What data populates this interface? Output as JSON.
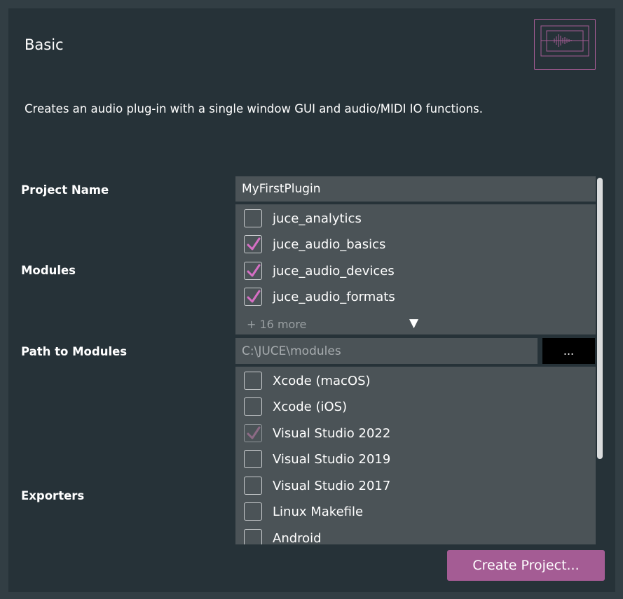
{
  "template": {
    "title": "Basic",
    "description": "Creates an audio plug-in with a single window GUI and audio/MIDI IO functions."
  },
  "form": {
    "project_name_label": "Project Name",
    "project_name_value": "MyFirstPlugin",
    "modules_label": "Modules",
    "modules": [
      {
        "label": "juce_analytics",
        "checked": false
      },
      {
        "label": "juce_audio_basics",
        "checked": true
      },
      {
        "label": "juce_audio_devices",
        "checked": true
      },
      {
        "label": "juce_audio_formats",
        "checked": true
      }
    ],
    "modules_more": "+ 16 more",
    "modules_expand_glyph": "▼",
    "path_label": "Path to Modules",
    "path_value": "C:\\JUCE\\modules",
    "browse_label": "...",
    "exporters_label": "Exporters",
    "exporters": [
      {
        "label": "Xcode (macOS)",
        "checked": false
      },
      {
        "label": "Xcode (iOS)",
        "checked": false
      },
      {
        "label": "Visual Studio 2022",
        "checked": true,
        "disabled": true
      },
      {
        "label": "Visual Studio 2019",
        "checked": false
      },
      {
        "label": "Visual Studio 2017",
        "checked": false
      },
      {
        "label": "Linux Makefile",
        "checked": false
      },
      {
        "label": "Android",
        "checked": false
      }
    ]
  },
  "actions": {
    "create_label": "Create Project..."
  },
  "colors": {
    "accent": "#a45c94",
    "check_active": "#d56fc4",
    "check_disabled": "#8c6a85"
  }
}
